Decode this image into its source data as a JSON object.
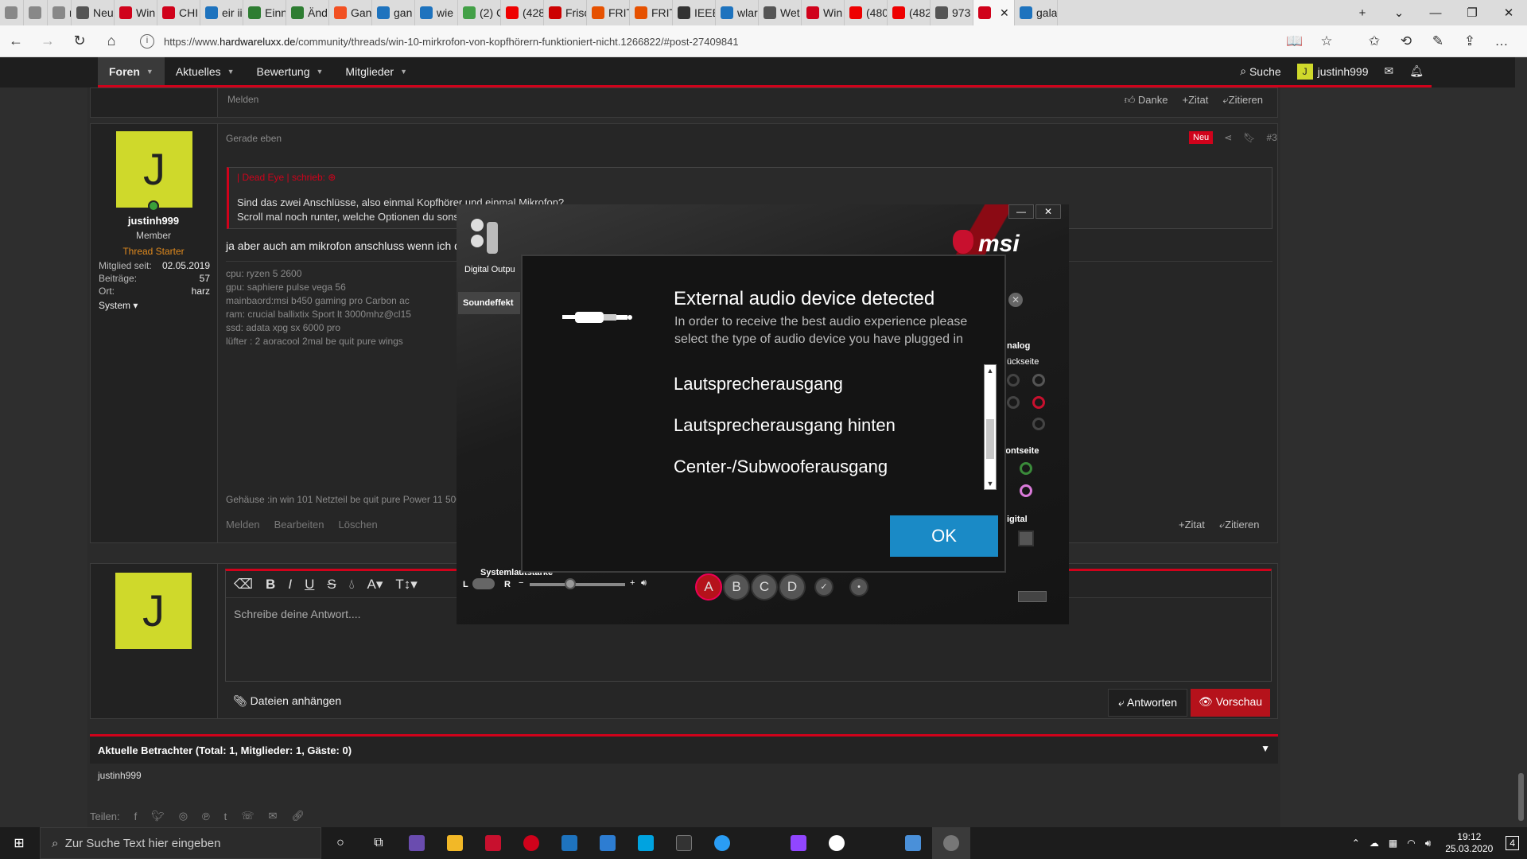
{
  "browser": {
    "tabs": [
      {
        "label": "",
        "icon": "tab-switch-icon",
        "color": "#888"
      },
      {
        "label": "",
        "icon": "back-tab-icon",
        "color": "#888"
      },
      {
        "label": "n",
        "icon": "arrow-icon",
        "color": "#888"
      },
      {
        "label": "Neu",
        "icon": "window-icon",
        "color": "#555"
      },
      {
        "label": "Win",
        "icon": "wiki-icon",
        "color": "#d0021b"
      },
      {
        "label": "CHI",
        "icon": "wiki-icon",
        "color": "#d0021b"
      },
      {
        "label": "eir ii",
        "icon": "b-icon",
        "color": "#1e73be"
      },
      {
        "label": "Einn",
        "icon": "x-icon",
        "color": "#2e7d32"
      },
      {
        "label": "Änd",
        "icon": "x-icon",
        "color": "#2e7d32"
      },
      {
        "label": "Gan",
        "icon": "ms-icon",
        "color": "#f25022"
      },
      {
        "label": "gan",
        "icon": "b-icon",
        "color": "#1e73be"
      },
      {
        "label": "wie",
        "icon": "b-icon",
        "color": "#1e73be"
      },
      {
        "label": "(2) C",
        "icon": "chat-icon",
        "color": "#43a047"
      },
      {
        "label": "(428",
        "icon": "yt-icon",
        "color": "#e00"
      },
      {
        "label": "Frisc",
        "icon": "fritz-icon",
        "color": "#c00"
      },
      {
        "label": "FRIT",
        "icon": "fritz-icon",
        "color": "#e65100"
      },
      {
        "label": "FRIT",
        "icon": "fritz-icon",
        "color": "#e65100"
      },
      {
        "label": "IEEE",
        "icon": "w-icon",
        "color": "#333"
      },
      {
        "label": "wlar",
        "icon": "b-icon",
        "color": "#1e73be"
      },
      {
        "label": "Wet",
        "icon": "window-icon",
        "color": "#555"
      },
      {
        "label": "Win",
        "icon": "wiki-icon",
        "color": "#d0021b"
      },
      {
        "label": "(480",
        "icon": "yt-icon",
        "color": "#e00"
      },
      {
        "label": "(482",
        "icon": "yt-icon",
        "color": "#e00"
      },
      {
        "label": "973",
        "icon": "window-icon",
        "color": "#555"
      },
      {
        "label": "",
        "icon": "hwl-icon",
        "color": "#d0021b",
        "active": true
      },
      {
        "label": "gala",
        "icon": "b-icon",
        "color": "#1e73be"
      }
    ],
    "url_prefix": "https://www.",
    "url_host": "hardwareluxx.de",
    "url_path": "/community/threads/win-10-mirkrofon-von-kopfhörern-funktioniert-nicht.1266822/#post-27409841"
  },
  "forum_nav": {
    "items": [
      {
        "label": "Foren",
        "active": true
      },
      {
        "label": "Aktuelles"
      },
      {
        "label": "Bewertung"
      },
      {
        "label": "Mitglieder"
      }
    ],
    "search": "Suche",
    "user": "justinh999",
    "user_initial": "J"
  },
  "prev_post": {
    "report": "Melden",
    "thanks": "Danke",
    "quote": "+Zitat",
    "reply": "Zitieren"
  },
  "post": {
    "time": "Gerade eben",
    "badge": "Neu",
    "number": "#3",
    "author": "justinh999",
    "initial": "J",
    "role": "Member",
    "starter": "Thread Starter",
    "stats": [
      {
        "k": "Mitglied seit:",
        "v": "02.05.2019"
      },
      {
        "k": "Beiträge:",
        "v": "57"
      },
      {
        "k": "Ort:",
        "v": "harz"
      }
    ],
    "system": "System",
    "quote_author": "Dead Eye | schrieb:",
    "quote_lines": [
      "Sind das zwei Anschlüsse, also einmal Kopfhörer und einmal Mikrofon?",
      "Scroll mal noch runter, welche Optionen du sons"
    ],
    "body": "ja aber auch am mikrofon anschluss wenn ich d",
    "signature": [
      "cpu: ryzen 5 2600",
      "gpu: saphiere pulse vega 56",
      "mainbaord:msi b450 gaming pro Carbon ac",
      "ram: crucial ballixtix Sport lt 3000mhz@cl15",
      "ssd: adata xpg sx 6000 pro",
      "lüfter : 2 aoracool 2mal be quit pure wings"
    ],
    "signature_last": "Gehäuse :in win 101 Netzteil be quit pure Power 11 500",
    "actions": [
      "Melden",
      "Bearbeiten",
      "Löschen"
    ],
    "quote_btn": "+Zitat",
    "reply_btn": "Zitieren"
  },
  "editor": {
    "placeholder": "Schreibe deine Antwort....",
    "attach": "Dateien anhängen",
    "reply_btn": "Antworten",
    "preview_btn": "Vorschau"
  },
  "viewers": {
    "title": "Aktuelle Betrachter (Total: 1, Mitglieder: 1, Gäste: 0)",
    "names": "justinh999"
  },
  "share_label": "Teilen:",
  "msi_app": {
    "logo": "msi",
    "digital_output": "Digital Outpu",
    "sound_tab": "Soundeffekt",
    "analog": "nalog",
    "back": "ückseite",
    "front": "rontseite",
    "digital": "igital",
    "system_volume": "Systemlautstärke",
    "left": "L",
    "right": "R",
    "minus": "−",
    "plus": "+",
    "jack_buttons": [
      "A",
      "B",
      "C",
      "D"
    ]
  },
  "dialog": {
    "title": "External audio device detected",
    "desc": "In order to receive the best audio experience please select the type of audio device you have plugged in",
    "options": [
      "Lautsprecherausgang",
      "Lautsprecherausgang hinten",
      "Center-/Subwooferausgang"
    ],
    "ok": "OK"
  },
  "taskbar": {
    "search_placeholder": "Zur Suche Text hier eingeben",
    "time": "19:12",
    "date": "25.03.2020",
    "notification_count": "4"
  }
}
